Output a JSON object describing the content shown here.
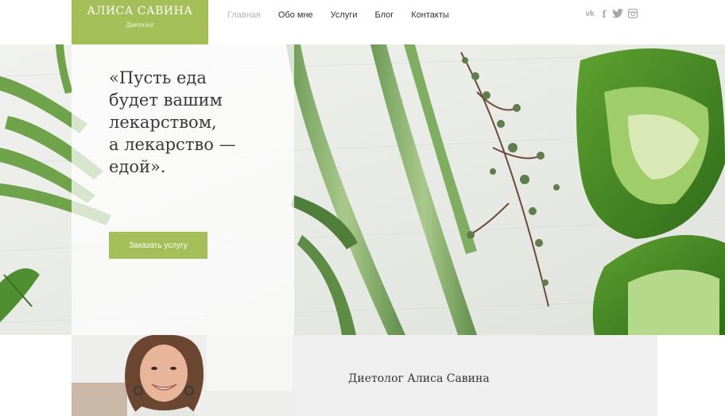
{
  "header": {
    "logo_name": "АЛИСА САВИНА",
    "logo_subtitle": "Диетолог",
    "nav": [
      {
        "label": "Главная",
        "active": true
      },
      {
        "label": "Обо мне",
        "active": false
      },
      {
        "label": "Услуги",
        "active": false
      },
      {
        "label": "Блог",
        "active": false
      },
      {
        "label": "Контакты",
        "active": false
      }
    ],
    "social_icons": [
      "vk-icon",
      "facebook-icon",
      "twitter-icon",
      "instagram-icon"
    ],
    "social_labels": {
      "vk": "vk",
      "facebook": "f"
    }
  },
  "hero": {
    "quote_lines": [
      "«Пусть еда",
      "будет вашим",
      "лекарством,",
      "а лекарство —",
      "едой»."
    ],
    "cta_label": "Заказать услугу"
  },
  "bio": {
    "title": "Диетолог Алиса Савина"
  },
  "colors": {
    "accent": "#a4bf58",
    "nav_active": "#b6b6b6",
    "text": "#333333",
    "panel": "#efefef"
  }
}
